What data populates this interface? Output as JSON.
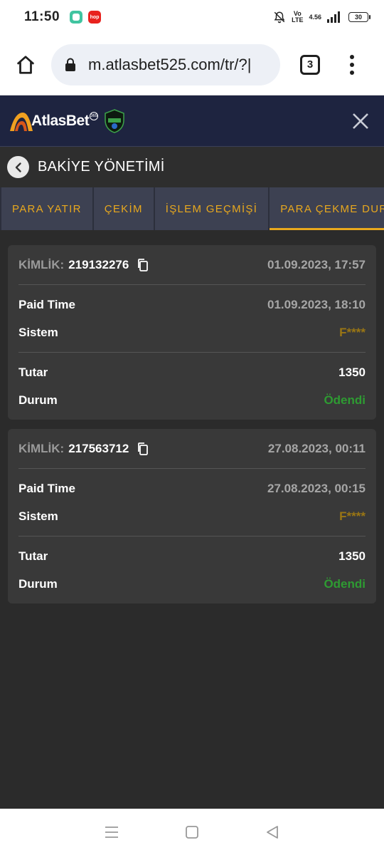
{
  "status": {
    "time": "11:50",
    "red_badge": "hop",
    "volte": "Vo\nLTE",
    "network": "4.56",
    "battery": "30"
  },
  "browser": {
    "url": "m.atlasbet525.com/tr/?|",
    "tab_count": "3"
  },
  "site": {
    "brand": "AtlasBet",
    "brand_badge": "365"
  },
  "page": {
    "title": "BAKİYE YÖNETİMİ"
  },
  "tabs": [
    {
      "label": "PARA YATIR"
    },
    {
      "label": "ÇEKİM"
    },
    {
      "label": "İŞLEM GEÇMİŞİ"
    },
    {
      "label": "PARA ÇEKME DURUMU"
    }
  ],
  "transactions": [
    {
      "id_label": "KİMLİK:",
      "id": "219132276",
      "date": "01.09.2023, 17:57",
      "paid_time_label": "Paid Time",
      "paid_time": "01.09.2023, 18:10",
      "system_label": "Sistem",
      "system": "F****",
      "amount_label": "Tutar",
      "amount": "1350",
      "status_label": "Durum",
      "status": "Ödendi"
    },
    {
      "id_label": "KİMLİK:",
      "id": "217563712",
      "date": "27.08.2023, 00:11",
      "paid_time_label": "Paid Time",
      "paid_time": "27.08.2023, 00:15",
      "system_label": "Sistem",
      "system": "F****",
      "amount_label": "Tutar",
      "amount": "1350",
      "status_label": "Durum",
      "status": "Ödendi"
    }
  ],
  "colors": {
    "accent": "#e8a81e",
    "header_bg": "#1e2440",
    "paid": "#2e9b32",
    "system": "#9a7614"
  }
}
